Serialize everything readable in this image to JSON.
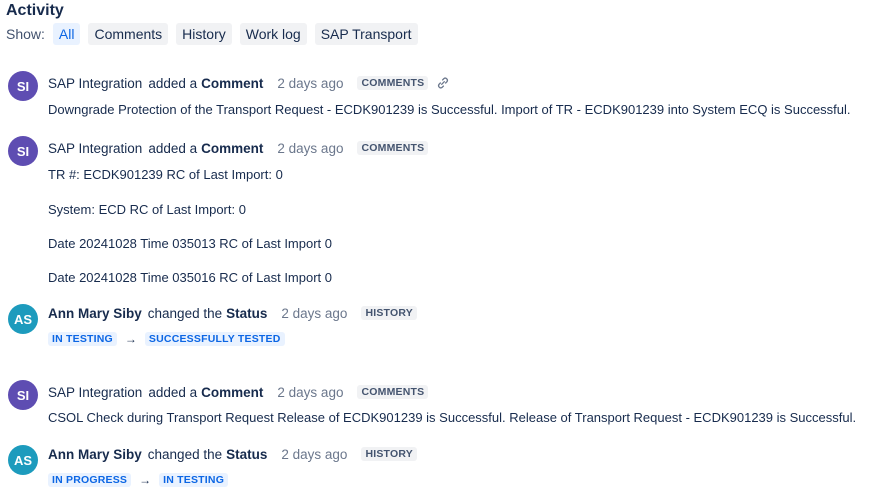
{
  "title": "Activity",
  "show_label": "Show:",
  "filters": [
    "All",
    "Comments",
    "History",
    "Work log",
    "SAP Transport"
  ],
  "entries": [
    {
      "avatar": "SI",
      "author": "SAP Integration",
      "verb": "added a",
      "object": "Comment",
      "time": "2 days ago",
      "tag": "COMMENTS",
      "lines": [
        "Downgrade Protection of the Transport Request - ECDK901239 is Successful. Import of TR - ECDK901239 into System ECQ is Successful."
      ]
    },
    {
      "avatar": "SI",
      "author": "SAP Integration",
      "verb": "added a",
      "object": "Comment",
      "time": "2 days ago",
      "tag": "COMMENTS",
      "lines": [
        "TR #: ECDK901239 RC of Last Import: 0",
        "System: ECD RC of Last Import: 0",
        "Date 20241028 Time 035013 RC of Last Import 0",
        "Date 20241028 Time 035016 RC of Last Import 0"
      ]
    },
    {
      "avatar": "AS",
      "author": "Ann Mary Siby",
      "verb": "changed the",
      "object": "Status",
      "time": "2 days ago",
      "tag": "HISTORY",
      "from_status": "IN TESTING",
      "to_status": "SUCCESSFULLY TESTED"
    },
    {
      "avatar": "SI",
      "author": "SAP Integration",
      "verb": "added a",
      "object": "Comment",
      "time": "2 days ago",
      "tag": "COMMENTS",
      "lines": [
        "CSOL Check during Transport Request Release of ECDK901239 is Successful. Release of Transport Request - ECDK901239 is Successful."
      ]
    },
    {
      "avatar": "AS",
      "author": "Ann Mary Siby",
      "verb": "changed the",
      "object": "Status",
      "time": "2 days ago",
      "tag": "HISTORY",
      "from_status": "IN PROGRESS",
      "to_status": "IN TESTING"
    }
  ],
  "icons": {
    "permalink": "link-icon",
    "transition": "arrow-right-icon"
  }
}
